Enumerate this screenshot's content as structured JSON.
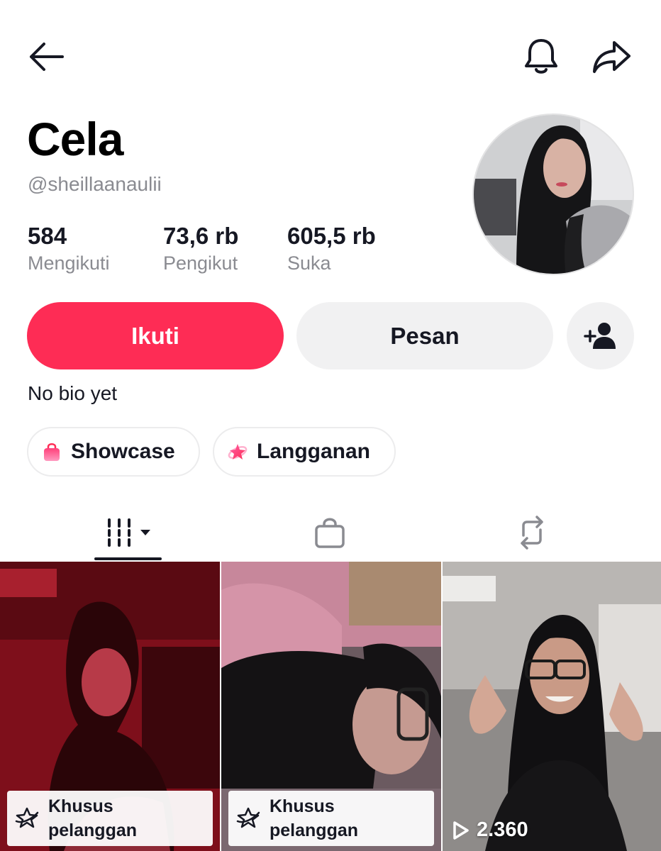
{
  "header": {
    "back_icon": "arrow-left-icon",
    "notification_icon": "bell-icon",
    "share_icon": "share-arrow-icon"
  },
  "profile": {
    "display_name": "Cela",
    "username": "@sheillaanaulii",
    "avatar": "profile-photo",
    "stats": [
      {
        "value": "584",
        "label": "Mengikuti"
      },
      {
        "value": "73,6 rb",
        "label": "Pengikut"
      },
      {
        "value": "605,5 rb",
        "label": "Suka"
      }
    ],
    "bio": "No bio yet"
  },
  "actions": {
    "follow_label": "Ikuti",
    "message_label": "Pesan",
    "add_friend_icon": "add-user-icon"
  },
  "chips": [
    {
      "label": "Showcase",
      "icon": "shopping-bag-icon"
    },
    {
      "label": "Langganan",
      "icon": "subscription-star-icon"
    }
  ],
  "tabs": [
    {
      "name": "videos",
      "icon": "grid-dropdown-icon",
      "active": true
    },
    {
      "name": "showcase",
      "icon": "bag-icon",
      "active": false
    },
    {
      "name": "reposts",
      "icon": "repost-icon",
      "active": false
    }
  ],
  "videos": [
    {
      "badge": [
        "Khusus",
        "pelanggan"
      ],
      "thumb_color": "#9b1020"
    },
    {
      "badge": [
        "Khusus",
        "pelanggan"
      ],
      "thumb_color": "#6d5560"
    },
    {
      "views": "2.360",
      "thumb_color": "#8d8a88"
    }
  ],
  "colors": {
    "accent": "#fe2c55",
    "secondary_button": "#f1f1f2",
    "muted_text": "#8a8b91"
  }
}
